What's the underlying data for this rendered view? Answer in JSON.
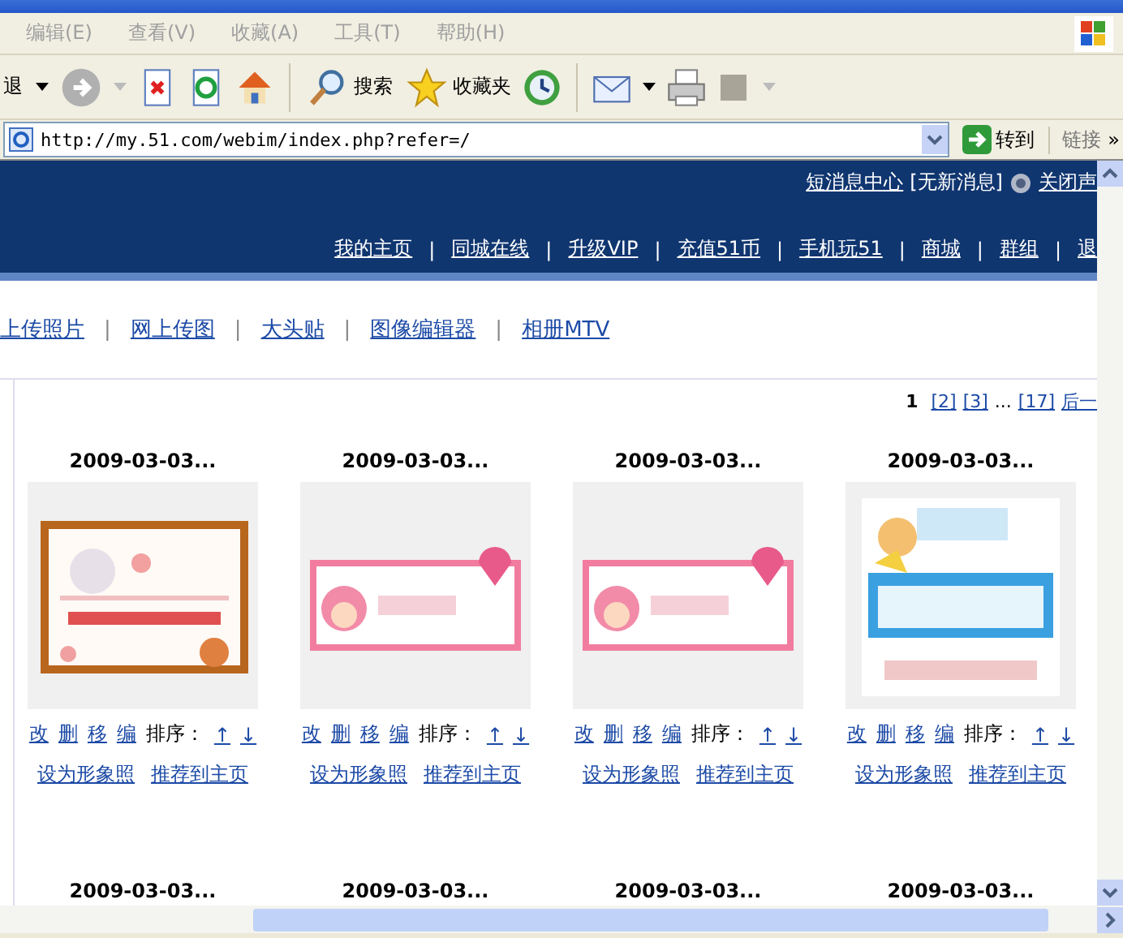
{
  "menu": [
    "编辑(E)",
    "查看(V)",
    "收藏(A)",
    "工具(T)",
    "帮助(H)"
  ],
  "toolbar": {
    "back": "退",
    "search": "搜索",
    "favorites": "收藏夹"
  },
  "address": {
    "value": "http://my.51.com/webim/index.php?refer=/",
    "go": "转到",
    "links": "链接",
    "more": "»"
  },
  "header": {
    "messages": "短消息中心",
    "status": "[无新消息]",
    "sound": "关闭声",
    "separator": "|",
    "nav": [
      "我的主页",
      "同城在线",
      "升级VIP",
      "充值51币",
      "手机玩51",
      "商城",
      "群组",
      "退"
    ]
  },
  "subnav": [
    "上传照片",
    "网上传图",
    "大头贴",
    "图像编辑器",
    "相册MTV"
  ],
  "subnav_separator": "|",
  "pagination": [
    {
      "label": "1",
      "selected": true
    },
    {
      "label": "[2]",
      "selected": false
    },
    {
      "label": "[3]",
      "selected": false
    },
    {
      "label": "...",
      "kind": "gap",
      "selected": false
    },
    {
      "label": "[17]",
      "selected": false
    },
    {
      "label": "后一",
      "kind": "next",
      "selected": false
    }
  ],
  "photos": [
    {
      "title": "2009-03-03...",
      "kind": "picture",
      "actions": [
        "改",
        "删",
        "移",
        "编"
      ],
      "sort": "排序：",
      "up": "↑",
      "down": "↓",
      "links": [
        "设为形象照",
        "推荐到主页"
      ]
    },
    {
      "title": "2009-03-03...",
      "kind": "picture",
      "actions": [
        "改",
        "删",
        "移",
        "编"
      ],
      "sort": "排序：",
      "up": "↑",
      "down": "↓",
      "links": [
        "设为形象照",
        "推荐到主页"
      ]
    },
    {
      "title": "2009-03-03...",
      "kind": "picture",
      "actions": [
        "改",
        "删",
        "移",
        "编"
      ],
      "sort": "排序：",
      "up": "↑",
      "down": "↓",
      "links": [
        "设为形象照",
        "推荐到主页"
      ]
    },
    {
      "title": "2009-03-03...",
      "kind": "picture",
      "actions": [
        "改",
        "删",
        "移",
        "编"
      ],
      "sort": "排序：",
      "up": "↑",
      "down": "↓",
      "links": [
        "设为形象照",
        "推荐到主页"
      ]
    }
  ],
  "next_row": [
    "2009-03-03...",
    "2009-03-03...",
    "2009-03-03...",
    "2009-03-03..."
  ]
}
